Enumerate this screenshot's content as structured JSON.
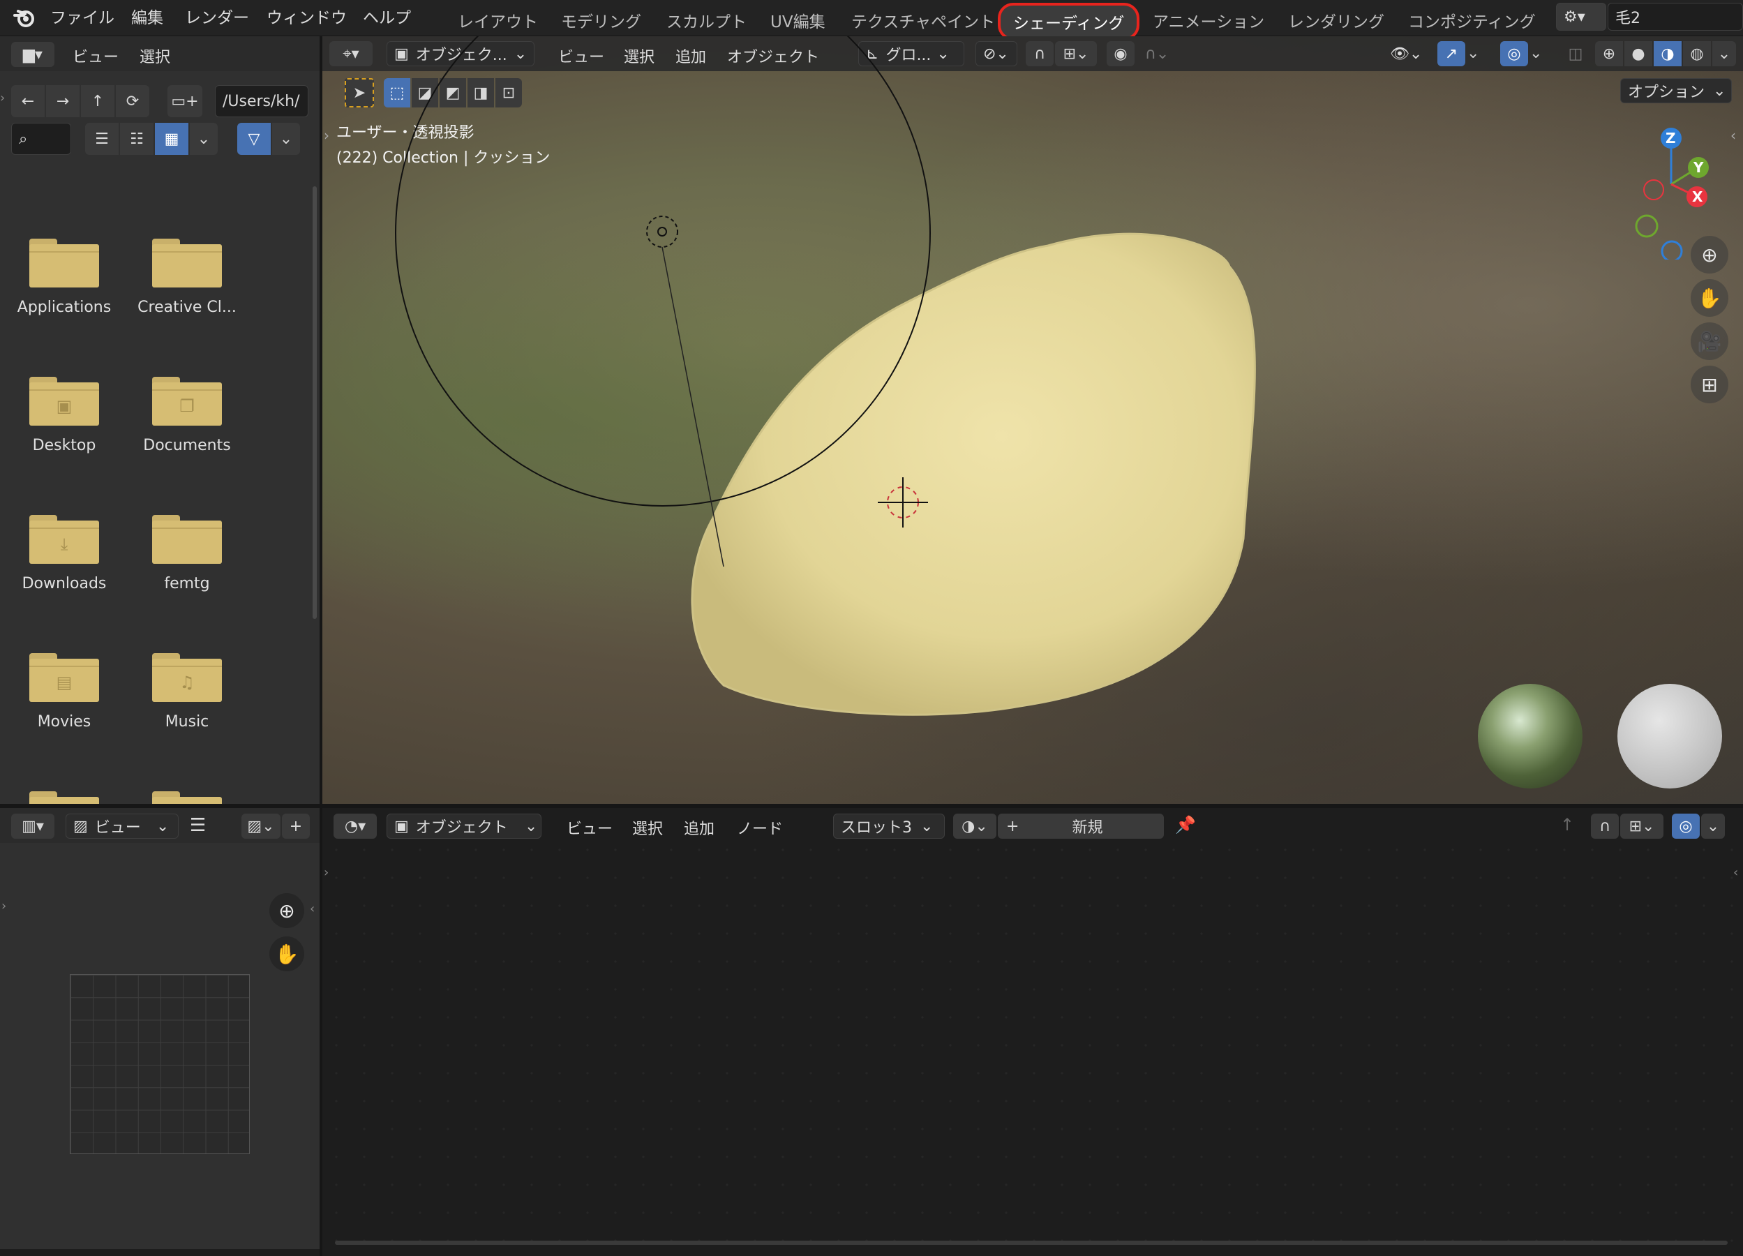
{
  "topbar": {
    "menus": [
      "ファイル",
      "編集",
      "レンダー",
      "ウィンドウ",
      "ヘルプ"
    ],
    "workspaces": [
      "レイアウト",
      "モデリング",
      "スカルプト",
      "UV編集",
      "テクスチャペイント",
      "シェーディング",
      "アニメーション",
      "レンダリング",
      "コンポジティング"
    ],
    "active_workspace": "シェーディング",
    "scene_name": "毛2"
  },
  "file_browser": {
    "menus": [
      "ビュー",
      "選択"
    ],
    "path": "/Users/kh/",
    "folders": [
      {
        "name": "Applications",
        "icon": "folder-icon"
      },
      {
        "name": "Creative Cl...",
        "icon": "folder-icon"
      },
      {
        "name": "Desktop",
        "icon": "desktop-folder-icon"
      },
      {
        "name": "Documents",
        "icon": "documents-folder-icon"
      },
      {
        "name": "Downloads",
        "icon": "downloads-folder-icon"
      },
      {
        "name": "femtg",
        "icon": "folder-icon"
      },
      {
        "name": "Movies",
        "icon": "movies-folder-icon"
      },
      {
        "name": "Music",
        "icon": "music-folder-icon"
      }
    ]
  },
  "viewport": {
    "mode": "オブジェク...",
    "menus": [
      "ビュー",
      "選択",
      "追加",
      "オブジェクト"
    ],
    "transform": "グロ...",
    "options": "オプション",
    "overlay_line1": "ユーザー・透視投影",
    "overlay_line2": "(222) Collection | クッション",
    "axes": {
      "x": "X",
      "y": "Y",
      "z": "Z"
    },
    "colors": {
      "x": "#e8343f",
      "y": "#6ea72e",
      "z": "#2f7fd8",
      "fur": "#e8dca0"
    }
  },
  "image_editor": {
    "view": "ビュー"
  },
  "node_editor": {
    "mode": "オブジェクト",
    "menus": [
      "ビュー",
      "選択",
      "追加",
      "ノード"
    ],
    "slot": "スロット3",
    "new_label": "新規"
  }
}
